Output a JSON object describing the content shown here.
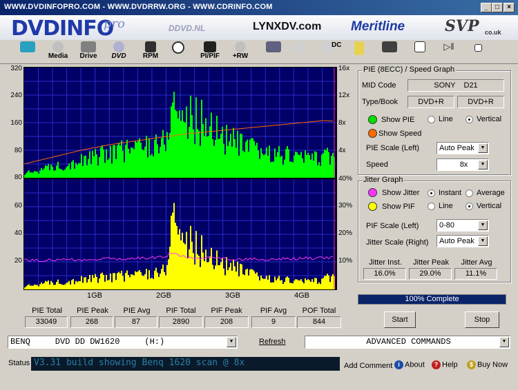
{
  "window": {
    "title": "WWW.DVDINFOPRO.COM  -  WWW.DVDRRW.ORG  -  WWW.CDRINFO.COM",
    "min": "_",
    "max": "□",
    "close": "×"
  },
  "banner": {
    "logo": "DVDINFO",
    "logo_pro": "pro",
    "sponsor1": "DDVD.NL",
    "sponsor2": "LYNXDV.com",
    "sponsor3": "Meritline",
    "sponsor4": "SVP",
    "sponsor4_sub": "co.uk"
  },
  "toolbar": {
    "media": "Media",
    "drive": "Drive",
    "dvd": "DVD",
    "rpm": "RPM",
    "pipif": "PI/PIF",
    "rw": "+RW",
    "dc": "DC"
  },
  "chart_data": [
    {
      "type": "area",
      "series": [
        {
          "name": "PIE",
          "color": "#00ff00"
        },
        {
          "name": "Speed",
          "color": "#ff6a00"
        }
      ],
      "y_left_ticks": [
        "320",
        "240",
        "160",
        "80"
      ],
      "y_right_ticks": [
        "16x",
        "12x",
        "8x",
        "4x"
      ],
      "ylim_left": [
        0,
        320
      ],
      "ylim_right": [
        0,
        16
      ],
      "x": [
        0.0,
        0.2,
        0.4,
        0.6,
        0.8,
        1.0,
        1.2,
        1.4,
        1.6,
        1.8,
        2.0,
        2.05,
        2.1,
        2.2,
        2.4,
        2.6,
        2.8,
        3.0,
        3.2,
        3.4,
        3.6,
        3.8,
        4.0,
        4.2,
        4.35
      ],
      "pie_values": [
        12,
        22,
        32,
        40,
        50,
        60,
        72,
        80,
        90,
        98,
        105,
        240,
        200,
        180,
        165,
        150,
        118,
        95,
        80,
        72,
        66,
        62,
        58,
        60,
        62
      ],
      "speed_values": [
        2.0,
        2.5,
        3.0,
        3.5,
        4.0,
        4.4,
        4.8,
        5.1,
        5.4,
        5.7,
        6.0,
        6.05,
        6.1,
        6.3,
        6.5,
        6.7,
        6.9,
        7.1,
        7.3,
        7.5,
        7.7,
        7.9,
        8.1,
        8.3,
        8.2
      ],
      "grid": true
    },
    {
      "type": "area",
      "series": [
        {
          "name": "PIF",
          "color": "#ffff00"
        },
        {
          "name": "Jitter",
          "color": "#ff33ff"
        }
      ],
      "y_left_ticks": [
        "80",
        "60",
        "40",
        "20"
      ],
      "y_right_ticks": [
        "40%",
        "30%",
        "20%",
        "10%"
      ],
      "ylim_left": [
        0,
        80
      ],
      "ylim_right": [
        0,
        40
      ],
      "x_ticks": [
        "1GB",
        "2GB",
        "3GB",
        "4GB"
      ],
      "xlim": [
        0,
        4.38
      ],
      "x": [
        0.0,
        0.2,
        0.4,
        0.6,
        0.8,
        1.0,
        1.2,
        1.4,
        1.6,
        1.8,
        2.0,
        2.05,
        2.1,
        2.2,
        2.4,
        2.6,
        2.8,
        3.0,
        3.2,
        3.4,
        3.6,
        3.8,
        4.0,
        4.2,
        4.35
      ],
      "pif_values": [
        2,
        4,
        5,
        6,
        7,
        8,
        9,
        10,
        11,
        12,
        14,
        62,
        50,
        38,
        30,
        24,
        18,
        14,
        10,
        8,
        7,
        6,
        6,
        7,
        10
      ],
      "jitter_values": [
        10.5,
        10.6,
        10.7,
        10.8,
        10.8,
        11.0,
        11.1,
        11.2,
        11.3,
        11.5,
        11.6,
        13.5,
        12.8,
        12.0,
        11.5,
        11.2,
        11.0,
        10.9,
        10.9,
        11.0,
        11.1,
        11.2,
        11.3,
        11.4,
        11.5
      ],
      "grid": true
    }
  ],
  "stats": {
    "labels": [
      "PIE Total",
      "PIE Peak",
      "PIE Avg",
      "PIF Total",
      "PIF Peak",
      "PIF Avg",
      "POF Total"
    ],
    "values": [
      "33049",
      "268",
      "87",
      "2890",
      "208",
      "9",
      "844"
    ]
  },
  "pie_panel": {
    "title": "PIE (8ECC) / Speed Graph",
    "mid_label": "MID Code",
    "mid_value": "SONY    D21",
    "type_label": "Type/Book",
    "type_value": "DVD+R",
    "book_value": "DVD+R",
    "show_pie": "Show PIE",
    "show_speed": "Show Speed",
    "line": "Line",
    "vertical": "Vertical",
    "scale_label": "PIE Scale (Left)",
    "scale_value": "Auto Peak",
    "speed_label": "Speed",
    "speed_value": "8x"
  },
  "jitter_panel": {
    "title": "Jitter Graph",
    "show_jitter": "Show Jitter",
    "instant": "Instant",
    "average": "Average",
    "show_pif": "Show PIF",
    "line": "Line",
    "vertical": "Vertical",
    "pif_scale_label": "PIF Scale (Left)",
    "pif_scale_value": "0-80",
    "jitter_scale_label": "Jitter Scale (Right)",
    "jitter_scale_value": "Auto Peak",
    "inst_label": "Jitter Inst.",
    "peak_label": "Jitter Peak",
    "avg_label": "Jitter Avg",
    "inst_value": "16.0%",
    "peak_value": "29.0%",
    "avg_value": "11.1%"
  },
  "progress": {
    "text": "100% Complete",
    "fraction": 1.0
  },
  "buttons": {
    "start": "Start",
    "stop": "Stop",
    "refresh": "Refresh"
  },
  "drive_select": "BENQ     DVD DD DW1620     (H:)",
  "commands_select": "ADVANCED COMMANDS",
  "status": {
    "label": "Status",
    "text": "V3.31 build showing Benq 1620 scan @ 8x",
    "add_comment": "Add Comment",
    "about": "About",
    "help": "Help",
    "buy": "Buy Now"
  },
  "colors": {
    "chart_bg": "#000066",
    "grid": "#2a2ad0",
    "pie": "#00ff00",
    "pif": "#ffff00",
    "speed": "#ff6a00",
    "jitter": "#ff33ff",
    "progress": "#0a246a"
  }
}
